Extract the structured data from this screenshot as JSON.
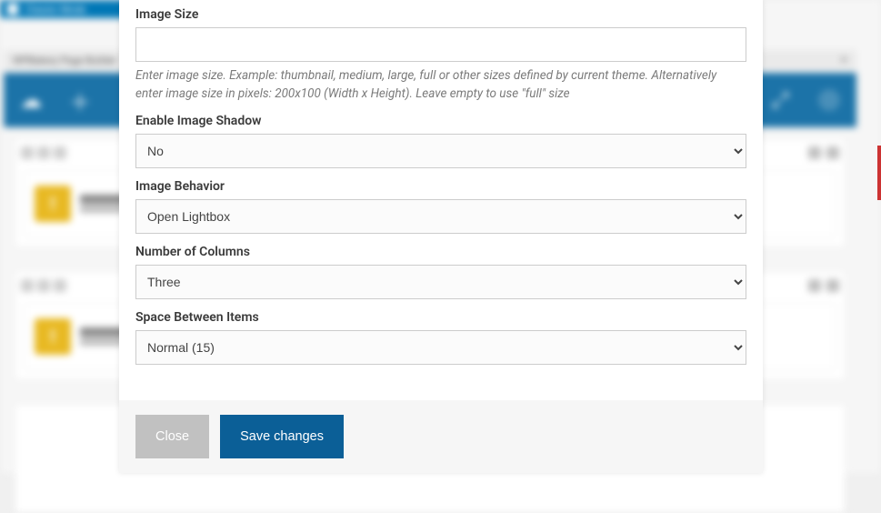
{
  "bg": {
    "title_bar": "Classic Mode",
    "panel_title": "WPBakery Page Builder",
    "element_label": "Image Gallery",
    "element_sub": "Gallery..."
  },
  "form": {
    "image_size": {
      "label": "Image Size",
      "value": "",
      "help": "Enter image size. Example: thumbnail, medium, large, full or other sizes defined by current theme. Alternatively enter image size in pixels: 200x100 (Width x Height). Leave empty to use \"full\" size"
    },
    "enable_shadow": {
      "label": "Enable Image Shadow",
      "value": "No"
    },
    "image_behavior": {
      "label": "Image Behavior",
      "value": "Open Lightbox"
    },
    "columns": {
      "label": "Number of Columns",
      "value": "Three"
    },
    "spacing": {
      "label": "Space Between Items",
      "value": "Normal (15)"
    }
  },
  "buttons": {
    "close": "Close",
    "save": "Save changes"
  }
}
